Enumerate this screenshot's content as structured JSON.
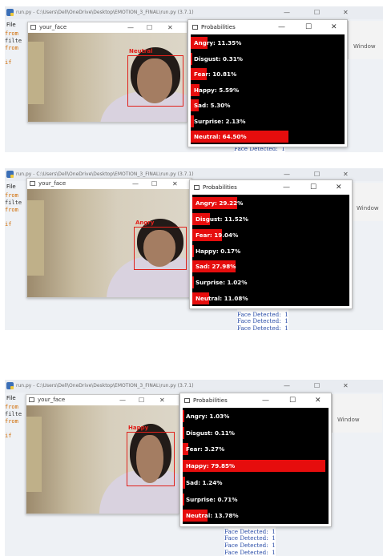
{
  "ide": {
    "title": "run.py - C:\\Users\\Dell\\OneDrive\\Desktop\\EMOTION_3_FINAL\\run.py (3.7.1)",
    "menu_file": "File",
    "code_lines": [
      "from",
      "filte",
      "from",
      "",
      "if"
    ],
    "window_label": "Window"
  },
  "camera_window": {
    "title": "your_face",
    "minimize": "—",
    "maximize": "☐",
    "close": "✕"
  },
  "prob_window": {
    "title": "Probabilities",
    "minimize": "—",
    "maximize": "☐",
    "close": "✕"
  },
  "shell": {
    "line": "Face Detected:  1"
  },
  "colors": {
    "bar": "#e60d0d",
    "box": "#e0211b",
    "shell_text": "#2b4ea8"
  },
  "panels": [
    {
      "face_label": "Neutral",
      "probabilities": [
        {
          "label": "Angry: 11.35%",
          "value": 11.35
        },
        {
          "label": "Disgust: 0.31%",
          "value": 0.31
        },
        {
          "label": "Fear: 10.81%",
          "value": 10.81
        },
        {
          "label": "Happy: 5.59%",
          "value": 5.59
        },
        {
          "label": "Sad: 5.30%",
          "value": 5.3
        },
        {
          "label": "Surprise: 2.13%",
          "value": 2.13
        },
        {
          "label": "Neutral: 64.50%",
          "value": 64.5
        }
      ],
      "shell_lines": [
        "Face Detected:  1",
        "Face Detected:  1",
        "Face Detected:  1",
        "Face Detected:  1"
      ]
    },
    {
      "face_label": "Angry",
      "probabilities": [
        {
          "label": "Angry: 29.22%",
          "value": 29.22
        },
        {
          "label": "Disgust: 11.52%",
          "value": 11.52
        },
        {
          "label": "Fear: 19.04%",
          "value": 19.04
        },
        {
          "label": "Happy: 0.17%",
          "value": 0.17
        },
        {
          "label": "Sad: 27.98%",
          "value": 27.98
        },
        {
          "label": "Surprise: 1.02%",
          "value": 1.02
        },
        {
          "label": "Neutral: 11.08%",
          "value": 11.08
        }
      ],
      "shell_lines": [
        "Face Detected:  1",
        "Face Detected:  1",
        "Face Detected:  1",
        "Face Detected:  1",
        "Face Detected:  1",
        "Face Detected:  1",
        "Face Detected:  1",
        "Face Detected:  1",
        "Face Detected:  1",
        "Face Detected:  1",
        "Face Detected:  1",
        "Face Detected:  1"
      ]
    },
    {
      "face_label": "Happy",
      "probabilities": [
        {
          "label": "Angry: 1.03%",
          "value": 1.03
        },
        {
          "label": "Disgust: 0.11%",
          "value": 0.11
        },
        {
          "label": "Fear: 3.27%",
          "value": 3.27
        },
        {
          "label": "Happy: 79.85%",
          "value": 79.85
        },
        {
          "label": "Sad: 1.24%",
          "value": 1.24
        },
        {
          "label": "Surprise: 0.71%",
          "value": 0.71
        },
        {
          "label": "Neutral: 13.78%",
          "value": 13.78
        }
      ],
      "shell_lines": [
        "Face Detected:  1",
        "Face Detected:  1",
        "Face Detected:  1",
        "Face Detected:  1",
        "Face Detected:  1"
      ]
    }
  ]
}
